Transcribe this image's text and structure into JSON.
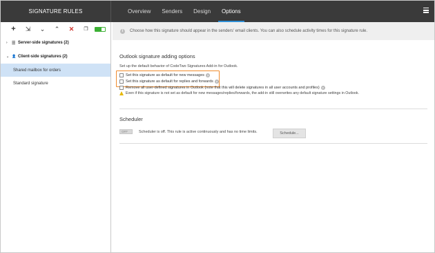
{
  "app": {
    "title": "SIGNATURE RULES"
  },
  "tabs": [
    {
      "label": "Overview"
    },
    {
      "label": "Senders"
    },
    {
      "label": "Design"
    },
    {
      "label": "Options"
    }
  ],
  "active_tab": "Options",
  "toolbar": {
    "icons": [
      "add-icon",
      "add-from-template-icon",
      "move-down-icon",
      "move-up-icon",
      "delete-icon",
      "duplicate-icon",
      "enable-toggle-icon"
    ],
    "glyphs": {
      "add": "+",
      "template": "⇲",
      "down": "⌄",
      "up": "⌃",
      "delete": "✕",
      "copy": "❐"
    }
  },
  "sidebar": {
    "groups": [
      {
        "label": "Server-side signatures (2)",
        "arrow": "›",
        "icon": "☰"
      },
      {
        "label": "Client-side signatures (2)",
        "arrow": "⌄",
        "icon": "👤"
      }
    ],
    "items": [
      {
        "label": "Shared mailbox for orders",
        "selected": true
      },
      {
        "label": "Standard signature",
        "selected": false
      }
    ]
  },
  "info": {
    "icon": "i",
    "text": "Choose how this signature should appear in the senders' email clients. You can also schedule activity times for this signature rule."
  },
  "outlook": {
    "title": "Outlook signature adding options",
    "description": "Set up the default behavior of CodeTwo Signatures Add-in for Outlook.",
    "options": [
      {
        "label": "Set this signature as default for new messages",
        "checked": false,
        "help": "?"
      },
      {
        "label": "Set this signature as default for replies and forwards",
        "checked": false,
        "help": "?"
      },
      {
        "label": "Remove all user-defined signatures in Outlook (note that this will delete signatures in all user accounts and profiles)",
        "checked": false,
        "help": "?"
      }
    ],
    "warning": "Even if this signature is not set as default for new messages/replies/forwards, the add-in still overwrites any default signature settings in Outlook."
  },
  "scheduler": {
    "title": "Scheduler",
    "toggle_label": "OFF",
    "status": "Scheduler is off. This rule is active continuously and has no time limits.",
    "button_label": "Schedule..."
  },
  "colors": {
    "topbar": "#3a3a3a",
    "accent": "#2f8fd6",
    "selected_row": "#cfe2f6",
    "highlight": "#f08a2b",
    "toggle_on": "#3cb034",
    "delete": "#d0302a"
  }
}
